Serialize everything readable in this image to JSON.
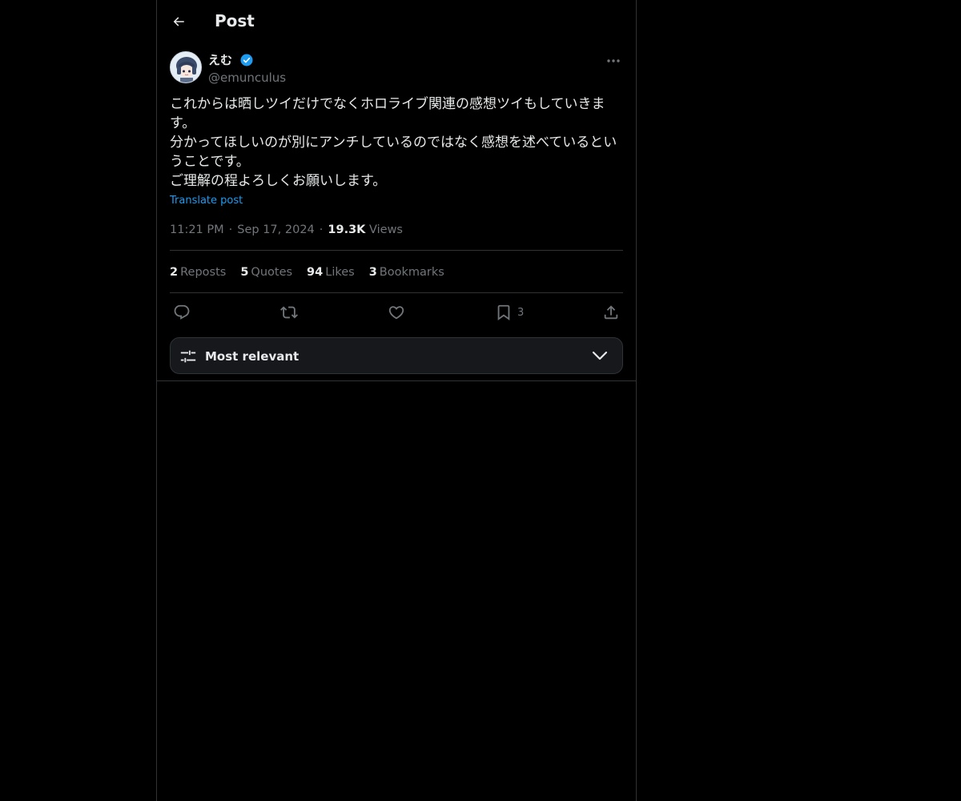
{
  "header": {
    "title": "Post",
    "back_icon": "arrow-left-icon"
  },
  "author": {
    "display_name": "えむ",
    "handle": "@emunculus",
    "verified": true,
    "verified_color": "#1d9bf0"
  },
  "post": {
    "text": "これからは晒しツイだけでなくホロライブ関連の感想ツイもしていきます。\n分かってほしいのが別にアンチしているのではなく感想を述べているということです。\nご理解の程よろしくお願いします。",
    "translate_label": "Translate post",
    "time": "11:21 PM",
    "date": "Sep 17, 2024",
    "views_count": "19.3K",
    "views_label": "Views"
  },
  "stats": {
    "reposts": {
      "count": "2",
      "label": "Reposts"
    },
    "quotes": {
      "count": "5",
      "label": "Quotes"
    },
    "likes": {
      "count": "94",
      "label": "Likes"
    },
    "bookmarks": {
      "count": "3",
      "label": "Bookmarks"
    }
  },
  "actions": {
    "reply_icon": "reply-icon",
    "repost_icon": "repost-icon",
    "like_icon": "heart-icon",
    "bookmark_icon": "bookmark-icon",
    "bookmark_count": "3",
    "share_icon": "share-icon"
  },
  "sort": {
    "label": "Most relevant"
  },
  "colors": {
    "background": "#000000",
    "text": "#e7e9ea",
    "muted": "#71767b",
    "link": "#1d9bf0",
    "border": "#2f3336"
  }
}
